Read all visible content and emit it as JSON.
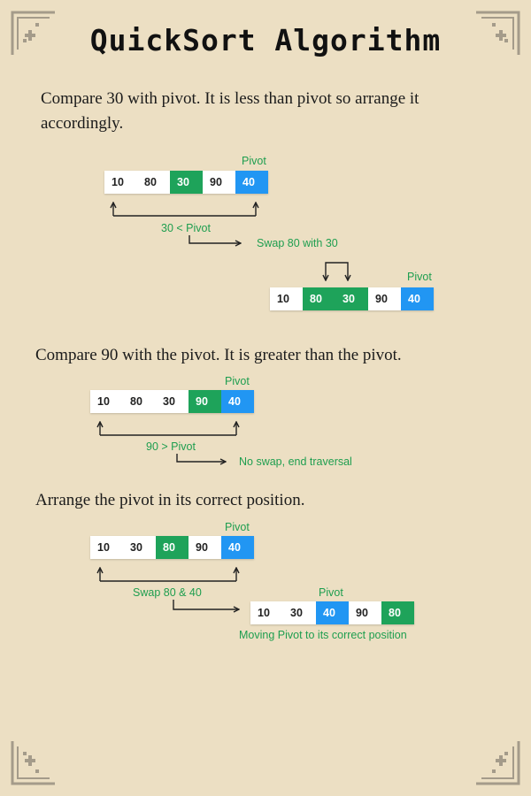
{
  "title": "QuickSort Algorithm",
  "colors": {
    "background": "#ecdfc3",
    "green": "#1ea35a",
    "blue": "#2196f3",
    "label": "#1e9e4f"
  },
  "section1": {
    "text": "Compare 30 with pivot. It is less than pivot so arrange it accordingly.",
    "array1": {
      "values": [
        "10",
        "80",
        "30",
        "90",
        "40"
      ],
      "highlight": [
        "none",
        "none",
        "green",
        "none",
        "blue"
      ],
      "pivot_label": "Pivot"
    },
    "compare_label": "30 < Pivot",
    "action_label": "Swap 80 with 30",
    "array2": {
      "values": [
        "10",
        "80",
        "30",
        "90",
        "40"
      ],
      "highlight": [
        "none",
        "green",
        "green",
        "none",
        "blue"
      ],
      "pivot_label": "Pivot"
    }
  },
  "section2": {
    "text": "Compare 90 with the pivot. It is greater than the pivot.",
    "array": {
      "values": [
        "10",
        "80",
        "30",
        "90",
        "40"
      ],
      "highlight": [
        "none",
        "none",
        "none",
        "green",
        "blue"
      ],
      "pivot_label": "Pivot"
    },
    "compare_label": "90 > Pivot",
    "action_label": "No swap, end traversal"
  },
  "section3": {
    "text": "Arrange the pivot in its correct position.",
    "array1": {
      "values": [
        "10",
        "30",
        "80",
        "90",
        "40"
      ],
      "highlight": [
        "none",
        "none",
        "green",
        "none",
        "blue"
      ],
      "pivot_label": "Pivot"
    },
    "swap_label": "Swap 80 & 40",
    "array2": {
      "values": [
        "10",
        "30",
        "40",
        "90",
        "80"
      ],
      "highlight": [
        "none",
        "none",
        "blue",
        "none",
        "green"
      ],
      "pivot_label": "Pivot"
    },
    "result_label": "Moving Pivot to its correct position"
  }
}
